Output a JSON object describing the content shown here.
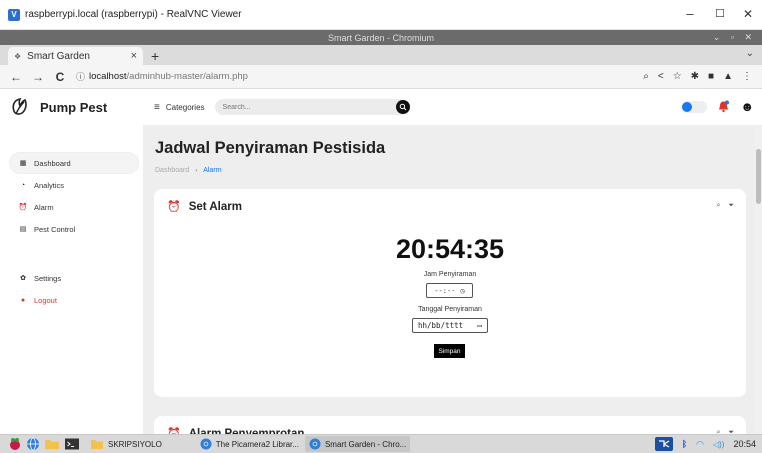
{
  "vnc": {
    "title": "raspberrypi.local (raspberrypi) - RealVNC Viewer",
    "logo_text": "V",
    "minimize": "–",
    "maximize": "☐",
    "close": "✕"
  },
  "browser": {
    "window_title": "Smart Garden - Chromium",
    "window_controls": "⌄ ▫ ✕",
    "tab": {
      "title": "Smart Garden",
      "close": "×",
      "favicon": "❖"
    },
    "new_tab": "+",
    "tabs_menu": "⌄",
    "back": "←",
    "forward": "→",
    "reload": "C",
    "info_icon": "ⓘ",
    "url_host": "localhost",
    "url_path": "/adminhub-master/alarm.php",
    "zoom_icon": "⌕",
    "share_icon": "<",
    "star_icon": "☆",
    "extensions_icon": "✱",
    "sidepanel_icon": "■",
    "profile_icon": "▲",
    "menu_icon": "⋮"
  },
  "app": {
    "brand": "Pump Pest",
    "categories_label": "Categories",
    "menu_icon": "≡",
    "search_placeholder": "Search...",
    "user_icon": "☻",
    "sidebar": [
      {
        "label": "Dashboard",
        "icon": "▦"
      },
      {
        "label": "Analytics",
        "icon": "◔"
      },
      {
        "label": "Alarm",
        "icon": "⏰"
      },
      {
        "label": "Pest Control",
        "icon": "▤"
      },
      {
        "label": "Settings",
        "icon": "✿"
      },
      {
        "label": "Logout",
        "icon": "●"
      }
    ],
    "page_title": "Jadwal Penyiraman Pestisida",
    "breadcrumb": {
      "home": "Dashboard",
      "sep": "›",
      "current": "Alarm"
    },
    "set_alarm": {
      "alarm_icon": "⏰",
      "title": "Set Alarm",
      "tools": [
        "⌕",
        "⏷"
      ],
      "clock": "20:54:35",
      "time_label": "Jam Penyiraman",
      "time_placeholder": "--:--",
      "time_icon": "◷",
      "date_label": "Tanggal Penyiraman",
      "date_placeholder": "hh/bb/tttt",
      "date_icon": "▭",
      "save_label": "Simpan"
    },
    "alarm_penyemprotan": {
      "alarm_icon": "⏰",
      "title": "Alarm Penyemprotan",
      "tools": [
        "⌕",
        "⏷"
      ]
    }
  },
  "taskbar": {
    "folder_label": "SKRIPSIYOLO",
    "tasks": [
      {
        "label": "The Picamera2 Librar..."
      },
      {
        "label": "Smart Garden - Chro..."
      }
    ],
    "clock": "20:54",
    "bluetooth_icon": "ᛒ",
    "wifi_icon": "◠",
    "volume_icon": "◁))"
  },
  "colors": {
    "accent": "#1877f2",
    "logout": "#e0332b",
    "content_bg": "#eeeeee"
  }
}
